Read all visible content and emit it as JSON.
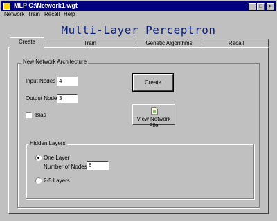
{
  "window": {
    "title": "MLP C:\\Network1.wgt",
    "minimize": "_",
    "maximize": "□",
    "close": "×"
  },
  "menu": [
    "Network",
    "Train",
    "Recall",
    "Help"
  ],
  "header": "Multi-Layer Perceptron",
  "tabs": [
    "Create",
    "Train",
    "Genetic Algorithms",
    "Recall"
  ],
  "create": {
    "group_title": "New Network Architecture",
    "input_nodes_label": "Input Nodes",
    "input_nodes_value": "4",
    "output_nodes_label": "Output Nodes",
    "output_nodes_value": "3",
    "bias_label": "Bias",
    "create_button": "Create",
    "view_button": "View Network File",
    "hidden": {
      "title": "Hidden Layers",
      "one_layer_label": "One Layer",
      "num_nodes_label": "Number of Nodes:",
      "num_nodes_value": "6",
      "multi_label": "2-5 Layers"
    }
  }
}
